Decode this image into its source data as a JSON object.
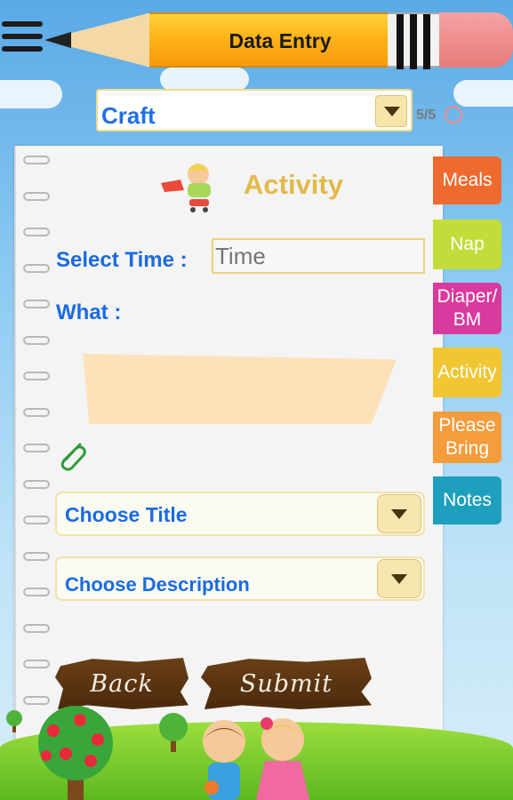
{
  "header": {
    "title": "Data Entry"
  },
  "activity_type": {
    "selected": "Craft",
    "counter": "5/5"
  },
  "page": {
    "heading": "Activity",
    "select_time_label": "Select Time :",
    "time_placeholder": "Time",
    "what_label": "What :",
    "choose_title": "Choose Title",
    "choose_description": "Choose Description",
    "back_label": "Back",
    "submit_label": "Submit"
  },
  "tabs": [
    {
      "label": "Meals",
      "color": "#ef6a2e"
    },
    {
      "label": "Nap",
      "color": "#c3dc3a"
    },
    {
      "label": "Diaper/ BM",
      "color": "#d93a9d"
    },
    {
      "label": "Activity",
      "color": "#f2c633"
    },
    {
      "label": "Please Bring",
      "color": "#f59c3c"
    },
    {
      "label": "Notes",
      "color": "#1e9fbd"
    }
  ],
  "icons": [
    "menu-icon",
    "pencil-banner-icon",
    "dropdown-arrow-icon",
    "clock-icon",
    "activity-kid-icon",
    "paperclip-icon"
  ]
}
